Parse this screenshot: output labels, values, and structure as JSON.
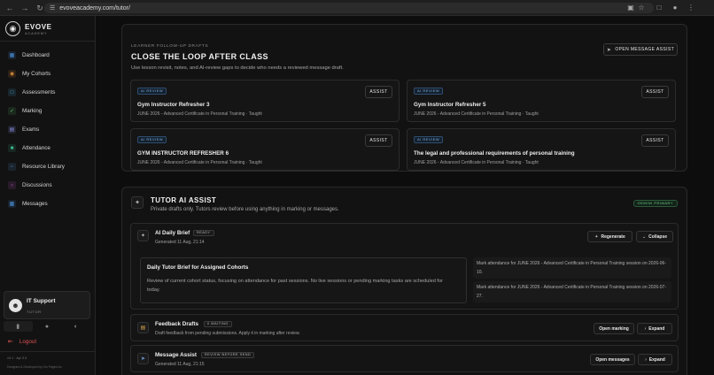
{
  "browser": {
    "url": "evoveacademy.com/tutor/"
  },
  "brand": {
    "name": "EVOVE",
    "sub": "ACADEMY"
  },
  "sidebar": {
    "items": [
      {
        "label": "Dashboard",
        "color": "#4a8fd8"
      },
      {
        "label": "My Cohorts",
        "color": "#d88a3a"
      },
      {
        "label": "Assessments",
        "color": "#4aa8d8"
      },
      {
        "label": "Marking",
        "color": "#5bbf6a"
      },
      {
        "label": "Exams",
        "color": "#8a8fe0"
      },
      {
        "label": "Attendance",
        "color": "#3fbf8f"
      },
      {
        "label": "Resource Library",
        "color": "#5a9ad8"
      },
      {
        "label": "Discussions",
        "color": "#c058c8"
      },
      {
        "label": "Messages",
        "color": "#4a8fd8"
      }
    ],
    "user": {
      "name": "IT Support",
      "role": "TUTOR"
    },
    "logout": "Logout",
    "version": "v3.1 · Api 3.3",
    "credit": "Designed & Developed by Oro Pages Inc."
  },
  "followup": {
    "eyebrow": "LEARNER FOLLOW-UP DRAFTS",
    "title": "CLOSE THE LOOP AFTER CLASS",
    "desc": "Use lesson revisit, notes, and AI-review gaps to decide who needs a reviewed message draft.",
    "open_button": "OPEN MESSAGE ASSIST",
    "badge": "AI REVIEW",
    "assist": "ASSIST",
    "cards": [
      {
        "title": "Gym Instructor Refresher 3",
        "sub": "JUNE 2026 - Advanced Certificate in Personal Training · Taught"
      },
      {
        "title": "Gym Instructor Refresher 5",
        "sub": "JUNE 2026 - Advanced Certificate in Personal Training · Taught"
      },
      {
        "title": "GYM INSTRUCTOR REFRESHER 6",
        "sub": "JUNE 2026 - Advanced Certificate in Personal Training · Taught"
      },
      {
        "title": "The legal and professional requirements of personal training",
        "sub": "JUNE 2026 - Advanced Certificate in Personal Training · Taught"
      }
    ]
  },
  "assist": {
    "title": "TUTOR AI ASSIST",
    "desc": "Private drafts only. Tutors review before using anything in marking or messages.",
    "badge": "GEMINI PRIMARY",
    "daily": {
      "title": "AI Daily Brief",
      "tag": "READY",
      "generated": "Generated 11 Aug, 21:14",
      "regenerate": "Regenerate",
      "collapse": "Collapse",
      "brief_title": "Daily Tutor Brief for Assigned Cohorts",
      "brief_body": "Review of current cohort status, focusing on attendance for past sessions. No live sessions or pending marking tasks are scheduled for today.",
      "items": [
        "Mark attendance for JUNE 2026 - Advanced Certificate in Personal Training session on 2026-06-10.",
        "Mark attendance for JUNE 2026 - Advanced Certificate in Personal Training session on 2026-07-27."
      ]
    },
    "feedback": {
      "title": "Feedback Drafts",
      "tag": "0 WAITING",
      "sub": "Draft feedback from pending submissions. Apply it in marking after review.",
      "open": "Open marking",
      "expand": "Expand"
    },
    "message": {
      "title": "Message Assist",
      "tag": "REVIEW BEFORE SEND",
      "sub": "Generated 11 Aug, 21:15",
      "open": "Open messages",
      "expand": "Expand"
    }
  }
}
